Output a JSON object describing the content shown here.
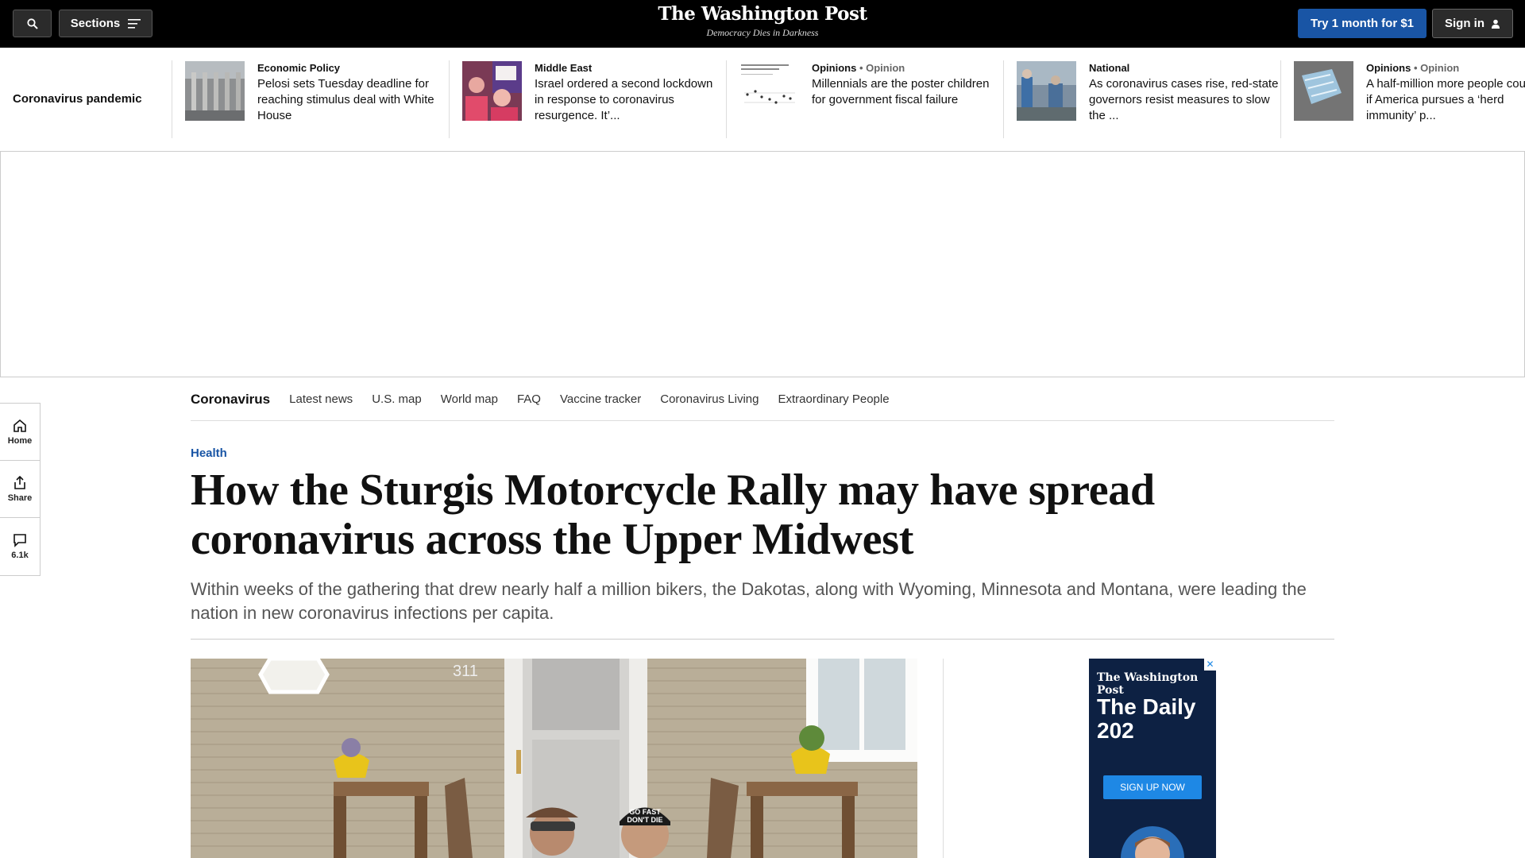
{
  "header": {
    "sections_label": "Sections",
    "logo": "The Washington Post",
    "tagline": "Democracy Dies in Darkness",
    "try_label": "Try 1 month for $1",
    "signin_label": "Sign in"
  },
  "strip": {
    "label": "Coronavirus pandemic",
    "stories": [
      {
        "kicker": "Economic Policy",
        "sub": "",
        "headline": "Pelosi sets Tuesday deadline for reaching stimulus deal with White House"
      },
      {
        "kicker": "Middle East",
        "sub": "",
        "headline": "Israel ordered a second lockdown in response to coronavirus resurgence. It’..."
      },
      {
        "kicker": "Opinions",
        "sub": " • Opinion",
        "headline": "Millennials are the poster children for government fiscal failure"
      },
      {
        "kicker": "National",
        "sub": "",
        "headline": "As coronavirus cases rise, red-state governors resist measures to slow the ..."
      },
      {
        "kicker": "Opinions",
        "sub": " • Opinion",
        "headline": "A half-million more people could die if America pursues a ‘herd immunity’ p..."
      }
    ]
  },
  "secnav": {
    "brand": "Coronavirus",
    "links": [
      "Latest news",
      "U.S. map",
      "World map",
      "FAQ",
      "Vaccine tracker",
      "Coronavirus Living",
      "Extraordinary People"
    ]
  },
  "rail": {
    "home": "Home",
    "share": "Share",
    "comments": "6.1k"
  },
  "article": {
    "kicker": "Health",
    "title": "How the Sturgis Motorcycle Rally may have spread coronavirus across the Upper Midwest",
    "dek": "Within weeks of the gathering that drew nearly half a million bikers, the Dakotas, along with Wyoming, Minnesota and Montana, were leading the nation in new coronavirus infections per capita.",
    "photo": {
      "house_number": "311",
      "cap_line1": "GO FAST",
      "cap_line2": "DON'T DIE"
    }
  },
  "sidead": {
    "logo": "The Washington Post",
    "title": "The Daily 202",
    "button": "SIGN UP NOW",
    "close": "✕"
  },
  "colors": {
    "accent": "#1955a5",
    "topbar": "#000000",
    "ad_bg": "#0d2143"
  }
}
